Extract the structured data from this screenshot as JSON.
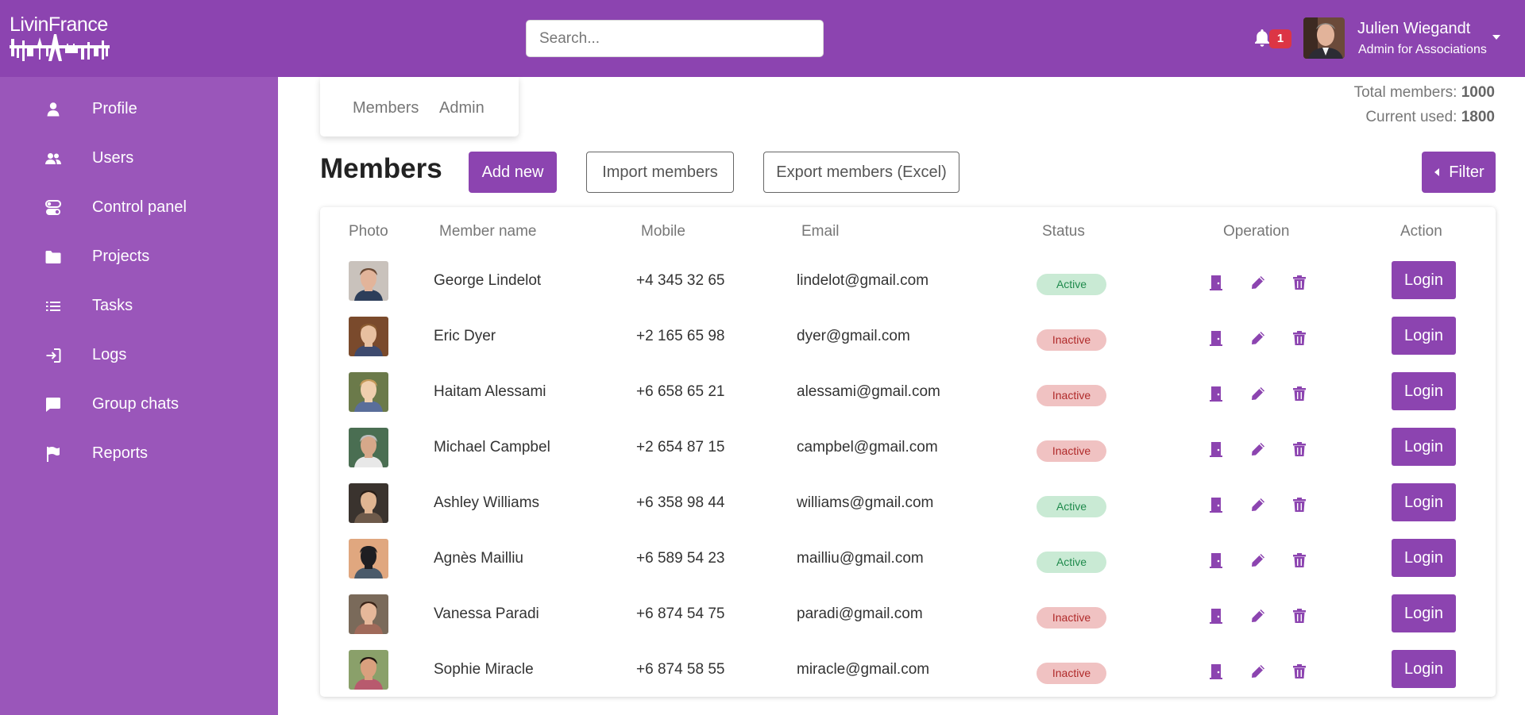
{
  "brand": {
    "name": "LivinFrance",
    "accent": "#8c44b0",
    "sidebar_bg": "#9a56ba"
  },
  "search": {
    "placeholder": "Search..."
  },
  "notifications": {
    "count": "1",
    "icon": "bell-icon"
  },
  "user": {
    "name": "Julien Wiegandt",
    "role": "Admin for Associations"
  },
  "sidebar": {
    "items": [
      {
        "label": "Profile",
        "icon": "user-icon"
      },
      {
        "label": "Users",
        "icon": "users-icon"
      },
      {
        "label": "Control panel",
        "icon": "toggle-icon"
      },
      {
        "label": "Projects",
        "icon": "folder-icon"
      },
      {
        "label": "Tasks",
        "icon": "list-icon"
      },
      {
        "label": "Logs",
        "icon": "sign-in-icon"
      },
      {
        "label": "Group chats",
        "icon": "chat-icon"
      },
      {
        "label": "Reports",
        "icon": "flag-icon"
      }
    ]
  },
  "tabs": [
    {
      "label": "Members"
    },
    {
      "label": "Admin"
    }
  ],
  "stats": {
    "total_label": "Total members:",
    "total_value": "1000",
    "used_label": "Current used:",
    "used_value": "1800"
  },
  "page": {
    "title": "Members",
    "add_label": "Add new",
    "import_label": "Import members",
    "export_label": "Export members (Excel)",
    "filter_label": "Filter"
  },
  "table": {
    "headers": {
      "photo": "Photo",
      "name": "Member name",
      "mobile": "Mobile",
      "email": "Email",
      "status": "Status",
      "operation": "Operation",
      "action": "Action"
    },
    "login_label": "Login",
    "status_colors": {
      "Active": "#c9ead4",
      "Inactive": "#f0c2c2"
    },
    "rows": [
      {
        "name": "George Lindelot",
        "mobile": "+4 345 32 65",
        "email": "lindelot@gmail.com",
        "status": "Active"
      },
      {
        "name": "Eric Dyer",
        "mobile": "+2 165 65 98",
        "email": "dyer@gmail.com",
        "status": "Inactive"
      },
      {
        "name": "Haitam Alessami",
        "mobile": "+6 658 65 21",
        "email": "alessami@gmail.com",
        "status": "Inactive"
      },
      {
        "name": "Michael Campbel",
        "mobile": "+2 654 87 15",
        "email": "campbel@gmail.com",
        "status": "Inactive"
      },
      {
        "name": "Ashley Williams",
        "mobile": "+6 358 98 44",
        "email": "williams@gmail.com",
        "status": "Active"
      },
      {
        "name": "Agnès Mailliu",
        "mobile": "+6 589 54 23",
        "email": "mailliu@gmail.com",
        "status": "Active"
      },
      {
        "name": "Vanessa Paradi",
        "mobile": "+6 874 54 75",
        "email": "paradi@gmail.com",
        "status": "Inactive"
      },
      {
        "name": "Sophie Miracle",
        "mobile": "+6 874 58 55",
        "email": "miracle@gmail.com",
        "status": "Inactive"
      }
    ]
  }
}
